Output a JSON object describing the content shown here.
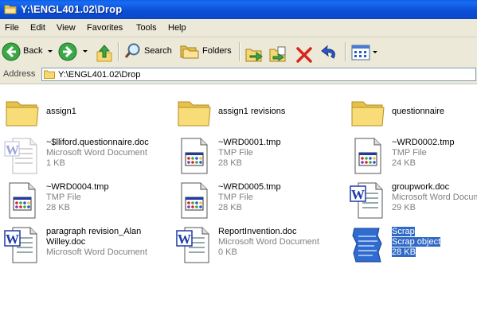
{
  "window": {
    "title": "Y:\\ENGL401.02\\Drop"
  },
  "menu": [
    "File",
    "Edit",
    "View",
    "Favorites",
    "Tools",
    "Help"
  ],
  "toolbar": {
    "back_label": "Back",
    "search_label": "Search",
    "folders_label": "Folders"
  },
  "address": {
    "label": "Address",
    "path": "Y:\\ENGL401.02\\Drop"
  },
  "items": [
    {
      "name": "assign1",
      "kind": "folder"
    },
    {
      "name": "assign1 revisions",
      "kind": "folder"
    },
    {
      "name": "questionnaire",
      "kind": "folder"
    },
    {
      "name": "~$lliford.questionnaire.doc",
      "type": "Microsoft Word Document",
      "size": "1 KB",
      "icon": "word-ghost-icon"
    },
    {
      "name": "~WRD0001.tmp",
      "type": "TMP File",
      "size": "28 KB",
      "icon": "tmp-file-icon"
    },
    {
      "name": "~WRD0002.tmp",
      "type": "TMP File",
      "size": "24 KB",
      "icon": "tmp-file-icon"
    },
    {
      "name": "~WRD0004.tmp",
      "type": "TMP File",
      "size": "28 KB",
      "icon": "tmp-file-icon"
    },
    {
      "name": "~WRD0005.tmp",
      "type": "TMP File",
      "size": "28 KB",
      "icon": "tmp-file-icon"
    },
    {
      "name": "groupwork.doc",
      "type": "Microsoft Word Document",
      "size": "29 KB",
      "icon": "word-doc-icon"
    },
    {
      "name": "paragraph revision_Alan Willey.doc",
      "type": "Microsoft Word Document",
      "size": "",
      "icon": "word-doc-icon"
    },
    {
      "name": "ReportInvention.doc",
      "type": "Microsoft Word Document",
      "size": "0 KB",
      "icon": "word-doc-icon"
    },
    {
      "name": "Scrap",
      "type": "Scrap object",
      "size": "28 KB",
      "icon": "scrap-icon",
      "selected": true
    }
  ],
  "colors": {
    "titlebar": "#0b4fd8",
    "selection": "#316ac5",
    "chrome": "#ece9d8",
    "folder": "#f5d873"
  }
}
